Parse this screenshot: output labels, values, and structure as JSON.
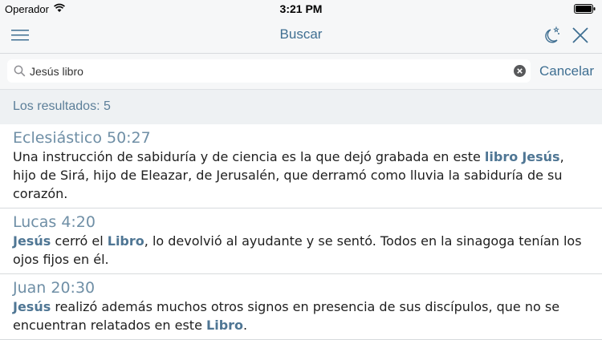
{
  "status_bar": {
    "carrier": "Operador",
    "time": "3:21 PM"
  },
  "nav": {
    "title": "Buscar",
    "icons": [
      "menu-icon",
      "night-mode-icon",
      "close-icon"
    ]
  },
  "search": {
    "value": "Jesús libro",
    "cancel_label": "Cancelar"
  },
  "results": {
    "count_label": "Los resultados: 5",
    "items": [
      {
        "reference": "Eclesiástico 50:27",
        "segments": [
          {
            "text": "Una instrucción de sabiduría y de ciencia es la que dejó grabada en este ",
            "highlight": false
          },
          {
            "text": "libro",
            "highlight": true
          },
          {
            "text": " ",
            "highlight": false
          },
          {
            "text": "Jesús",
            "highlight": true
          },
          {
            "text": ", hijo de Sirá, hijo de Eleazar, de Jerusalén, que derramó como lluvia la sabiduría de su corazón.",
            "highlight": false
          }
        ]
      },
      {
        "reference": "Lucas 4:20",
        "segments": [
          {
            "text": "Jesús",
            "highlight": true
          },
          {
            "text": " cerró el ",
            "highlight": false
          },
          {
            "text": "Libro",
            "highlight": true
          },
          {
            "text": ", lo devolvió al ayudante y se sentó. Todos en la sinagoga tenían los ojos fijos en él.",
            "highlight": false
          }
        ]
      },
      {
        "reference": "Juan 20:30",
        "segments": [
          {
            "text": "Jesús",
            "highlight": true
          },
          {
            "text": " realizó además muchos otros signos en presencia de sus discípulos, que no se encuentran relatados en este ",
            "highlight": false
          },
          {
            "text": "Libro",
            "highlight": true
          },
          {
            "text": ".",
            "highlight": false
          }
        ]
      }
    ]
  },
  "colors": {
    "accent": "#3f6f92",
    "highlight": "#4f7694",
    "reference": "#6f8fa6",
    "bar_background": "#f6f7f8"
  }
}
